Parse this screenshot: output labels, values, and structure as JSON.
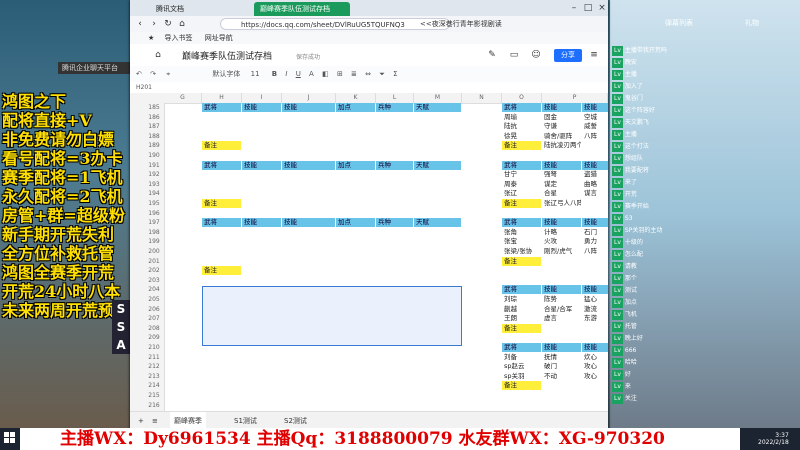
{
  "stream": {
    "promo_lines": [
      "鸿图之下",
      "配将直接+V",
      "非免费请勿白嫖",
      "看号配将=3办卡",
      "赛季配将=1飞机",
      "永久配将=2飞机",
      "房管+群=超级粉",
      "新手期开荒失利",
      "全方位补救托管",
      "鸿图全赛季开荒",
      "开荒24小时八本",
      "未来两周开荒预约"
    ],
    "side_letters": [
      "S",
      "S",
      "A"
    ],
    "mini_window_title": "腾讯企业聊天平台",
    "banner": "主播WX：Dy6961534  主播Qq：3188800079  水友群WX：XG-970320"
  },
  "browser": {
    "tabs": [
      {
        "label": "腾讯文档"
      },
      {
        "label": "巅峰赛季队伍测试存档"
      }
    ],
    "url": "https://docs.qq.com/sheet/DVlRuUG5TQUFNQ3",
    "addr_hint": "<<夜深巷行青年影视剧读",
    "bookmarks": [
      "导入书签",
      "网址导航"
    ]
  },
  "doc": {
    "title": "巅峰赛季队伍测试存档",
    "saved": "保存成功",
    "share_label": "分享",
    "font_name": "默认字体",
    "font_size": "11",
    "cell_ref": "H201"
  },
  "grid": {
    "col_headers": [
      "G",
      "H",
      "I",
      "J",
      "K",
      "L",
      "M",
      "N",
      "O",
      "P"
    ],
    "row_numbers": [
      "185",
      "186",
      "187",
      "188",
      "189",
      "190",
      "191",
      "192",
      "193",
      "194",
      "195",
      "196",
      "197",
      "198",
      "199",
      "200",
      "201",
      "202",
      "203",
      "204",
      "205",
      "206",
      "207",
      "208",
      "209",
      "210",
      "211",
      "212",
      "213",
      "214",
      "215",
      "216"
    ],
    "header_labels": [
      "武将",
      "技能",
      "技能",
      "加点",
      "兵种",
      "天赋"
    ],
    "note_label": "备注",
    "right_blocks": [
      {
        "rows": [
          [
            "周瑜",
            "固金",
            "空城"
          ],
          [
            "陆抗",
            "守谦",
            "威誓"
          ],
          [
            "徐晃",
            "骑舍/驱阵",
            "八阵"
          ],
          [
            "备注",
            "陆抗凌刃两个智力",
            ""
          ]
        ]
      },
      {
        "rows": [
          [
            "甘宁",
            "强弩",
            "盗猎"
          ],
          [
            "周泰",
            "谋定",
            "曲略"
          ],
          [
            "张辽",
            "合星",
            "谋言"
          ],
          [
            "备注",
            "张辽弓人八阵",
            ""
          ]
        ]
      },
      {
        "rows": [
          [
            "张角",
            "计略",
            "石门"
          ],
          [
            "张宝",
            "火攻",
            "勇力"
          ],
          [
            "张梁/张协",
            "刚烈/虎气",
            "八阵"
          ],
          [
            "备注",
            "",
            ""
          ]
        ]
      },
      {
        "rows": [
          [
            "刘琮",
            "陈势",
            "猛心"
          ],
          [
            "蒯越",
            "合星/合军",
            "激流"
          ],
          [
            "王朗",
            "虚言",
            "东游"
          ],
          [
            "备注",
            "",
            ""
          ]
        ]
      },
      {
        "rows": [
          [
            "刘备",
            "抚情",
            "炊心"
          ],
          [
            "sp赵云",
            "破门",
            "攻心"
          ],
          [
            "sp关羽",
            "不动",
            "攻心"
          ],
          [
            "备注",
            "",
            ""
          ]
        ]
      }
    ]
  },
  "sheets": [
    "巅峰赛季",
    "S1测试",
    "S2测试"
  ],
  "chat": {
    "title": "弹幕列表",
    "title2": "礼物",
    "messages": [
      "主播带我开荒吗",
      "晚安",
      "主播",
      "加入了",
      "鬼谷门",
      "这个阵容好",
      "天文鹏飞",
      "主播",
      "这个打法",
      "想组队",
      "我要配将",
      "来了",
      "开荒",
      "赛季开始",
      "S3",
      "SP关羽的主动",
      "十级的",
      "怎么配",
      "请教",
      "那个",
      "测试",
      "加点",
      "飞机",
      "托管",
      "晚上好",
      "666",
      "哈哈",
      "好",
      "来",
      "关注"
    ]
  },
  "clock": {
    "time": "3:37",
    "date": "2022/2/18"
  }
}
